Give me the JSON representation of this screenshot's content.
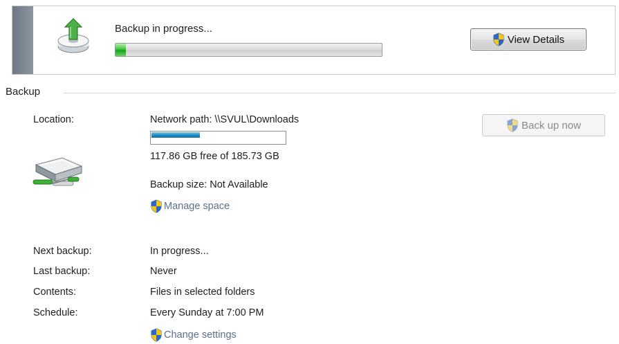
{
  "progress": {
    "title": "Backup in progress...",
    "fraction": 0.04,
    "view_details_label": "View Details"
  },
  "section": {
    "title": "Backup"
  },
  "details": {
    "location_label": "Location:",
    "location_value": "Network path: \\\\SVUL\\Downloads",
    "storage_used_fraction": 0.37,
    "free_space": "117.86 GB free of 185.73 GB",
    "backup_size": "Backup size: Not Available",
    "manage_space_label": "Manage space",
    "back_up_now_label": "Back up now",
    "rows": [
      {
        "label": "Next backup:",
        "value": "In progress..."
      },
      {
        "label": "Last backup:",
        "value": "Never"
      },
      {
        "label": "Contents:",
        "value": "Files in selected folders"
      },
      {
        "label": "Schedule:",
        "value": "Every Sunday at 7:00 PM"
      }
    ],
    "change_settings_label": "Change settings"
  },
  "colors": {
    "progress_fill": "#18a318",
    "storage_fill": "#1f8fc7",
    "link": "#5d6f8c",
    "accent_bar": "#7a838e"
  },
  "icons": {
    "progress": "backup-drive-upload-icon",
    "location": "network-drive-icon",
    "shield": "uac-shield-icon"
  }
}
